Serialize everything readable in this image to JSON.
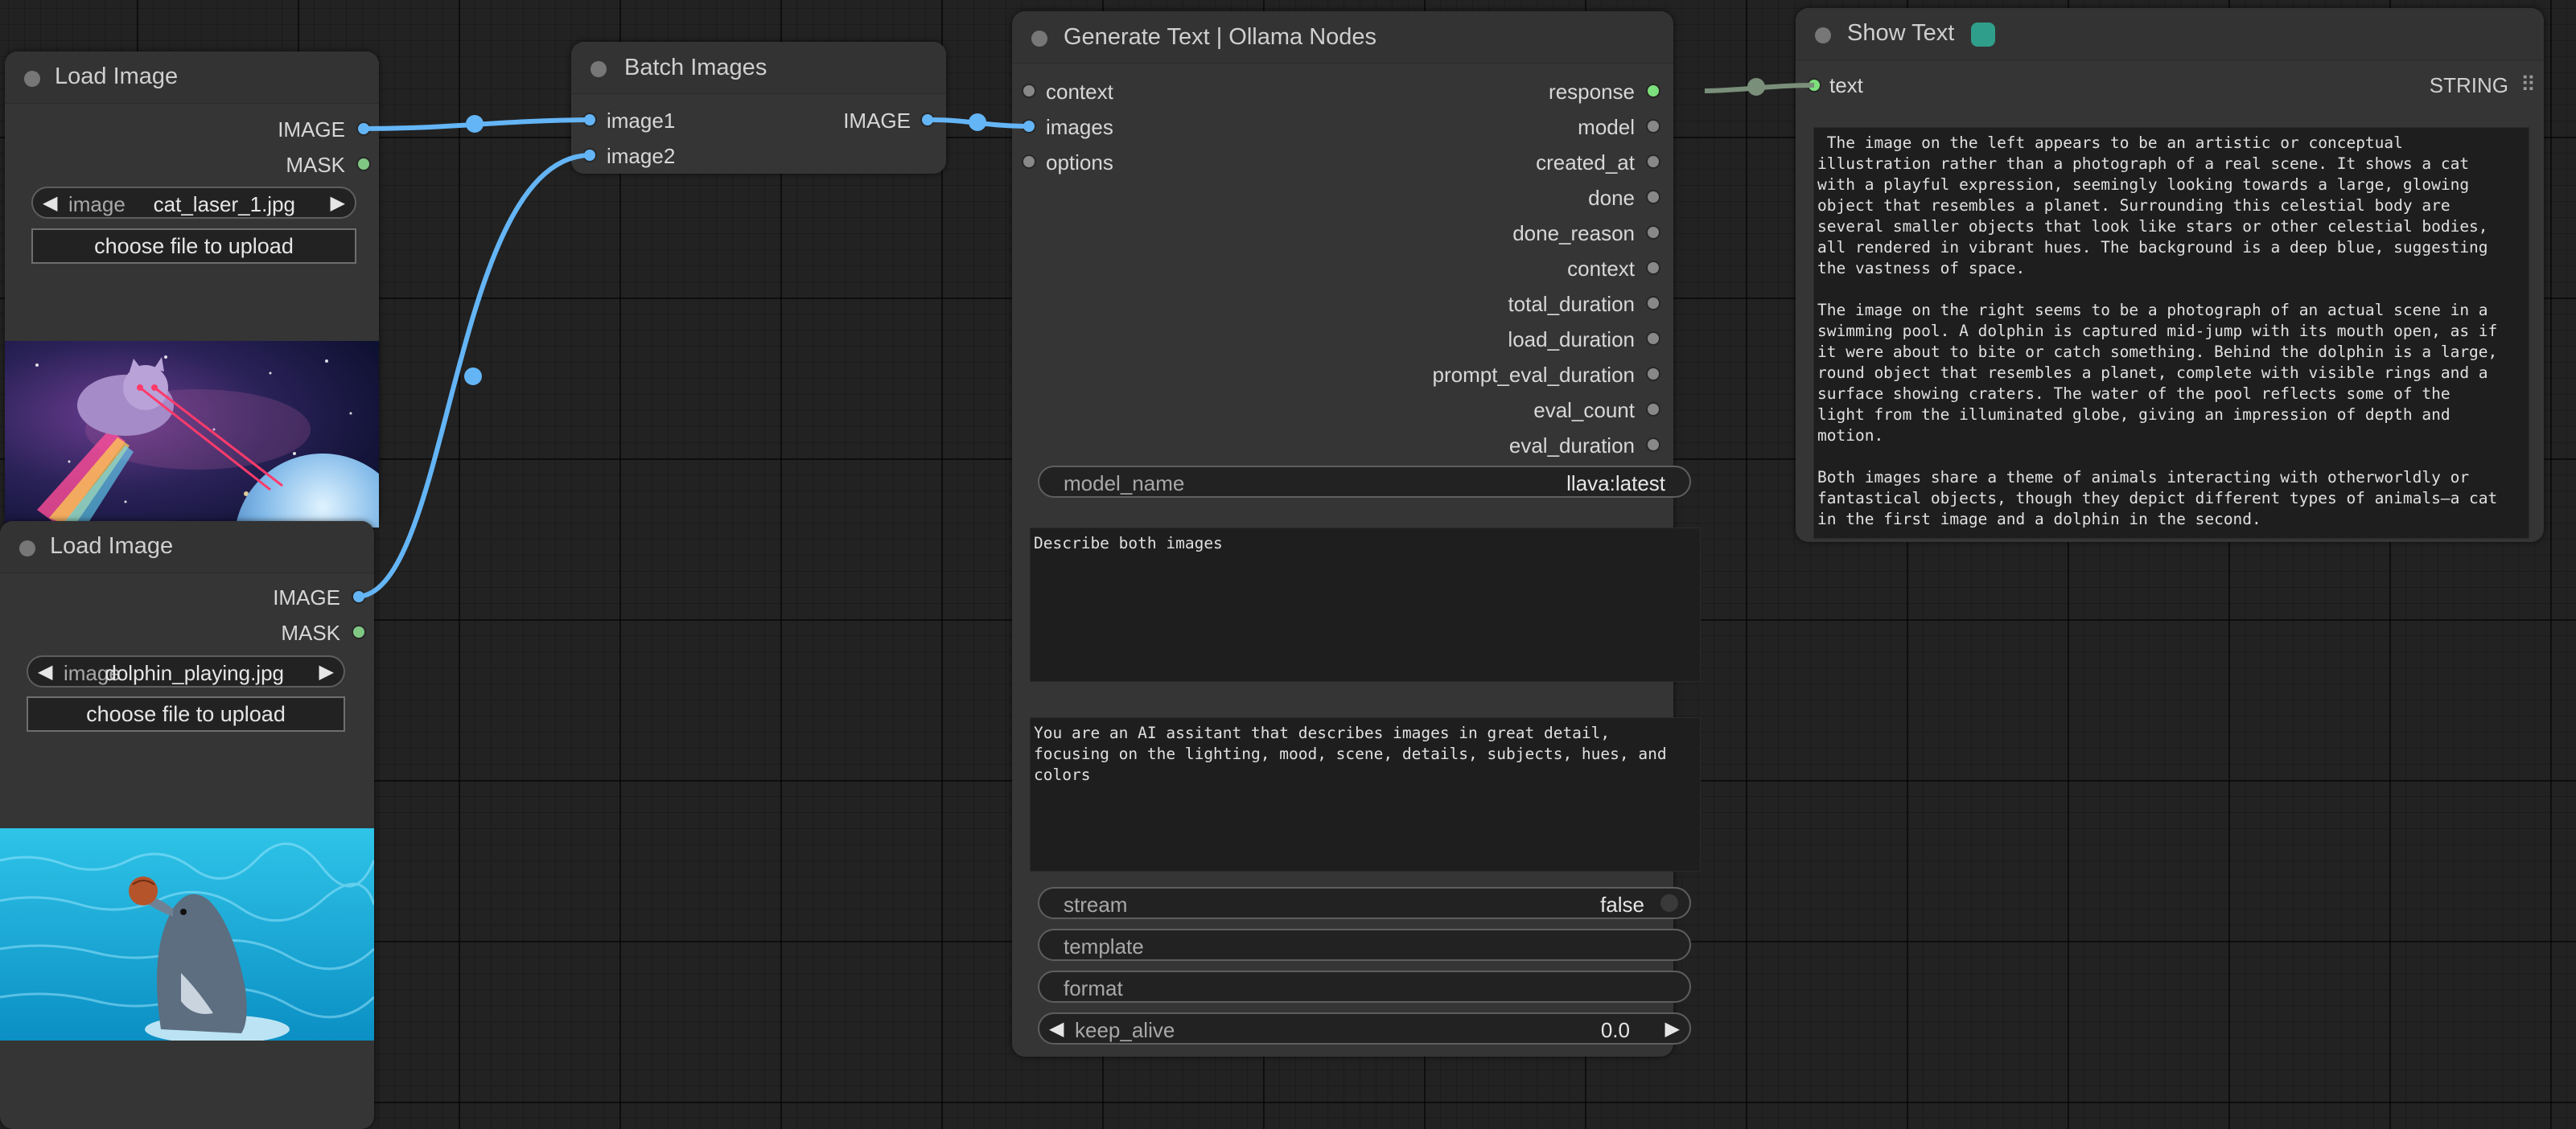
{
  "colors": {
    "canvas_bg": "#222222",
    "node_bg": "#353535",
    "image_link": "#64b5f6",
    "mask_socket": "#81c784",
    "string_socket": "#7ce07c",
    "string_link": "#7a8f7a",
    "idle_socket": "#888888"
  },
  "load_image_1": {
    "title": "Load Image",
    "outputs": [
      "IMAGE",
      "MASK"
    ],
    "image_widget": {
      "name": "image",
      "value": "cat_laser_1.jpg"
    },
    "upload_label": "choose file to upload",
    "preview_icon": "cat-laser-space-image"
  },
  "load_image_2": {
    "title": "Load Image",
    "outputs": [
      "IMAGE",
      "MASK"
    ],
    "image_widget": {
      "name": "image",
      "value": "dolphin_playing.jpg"
    },
    "upload_label": "choose file to upload",
    "preview_icon": "dolphin-pool-image"
  },
  "batch_images": {
    "title": "Batch Images",
    "inputs": [
      "image1",
      "image2"
    ],
    "outputs": [
      "IMAGE"
    ]
  },
  "generate_text": {
    "title": "Generate Text | Ollama Nodes",
    "inputs": [
      "context",
      "images",
      "options"
    ],
    "outputs": [
      "response",
      "model",
      "created_at",
      "done",
      "done_reason",
      "context",
      "total_duration",
      "load_duration",
      "prompt_eval_duration",
      "eval_count",
      "eval_duration"
    ],
    "model_name": {
      "name": "model_name",
      "value": "llava:latest"
    },
    "prompt": "Describe both images",
    "system": "You are an AI assitant that describes images in great detail,\nfocusing on the lighting, mood, scene, details, subjects, hues, and\ncolors",
    "stream": {
      "name": "stream",
      "value": "false"
    },
    "template": {
      "name": "template"
    },
    "format": {
      "name": "format"
    },
    "keep_alive": {
      "name": "keep_alive",
      "value": "0.0"
    }
  },
  "show_text": {
    "title": "Show Text",
    "title_icon": "ollama-icon",
    "inputs": [
      "text"
    ],
    "type_label": "STRING",
    "output_text": " The image on the left appears to be an artistic or conceptual\nillustration rather than a photograph of a real scene. It shows a cat\nwith a playful expression, seemingly looking towards a large, glowing\nobject that resembles a planet. Surrounding this celestial body are\nseveral smaller objects that look like stars or other celestial bodies,\nall rendered in vibrant hues. The background is a deep blue, suggesting\nthe vastness of space.\n\nThe image on the right seems to be a photograph of an actual scene in a\nswimming pool. A dolphin is captured mid-jump with its mouth open, as if\nit were about to bite or catch something. Behind the dolphin is a large,\nround object that resembles a planet, complete with visible rings and a\nsurface showing craters. The water of the pool reflects some of the\nlight from the illuminated globe, giving an impression of depth and\nmotion.\n\nBoth images share a theme of animals interacting with otherworldly or\nfantastical objects, though they depict different types of animals—a cat\nin the first image and a dolphin in the second."
  }
}
